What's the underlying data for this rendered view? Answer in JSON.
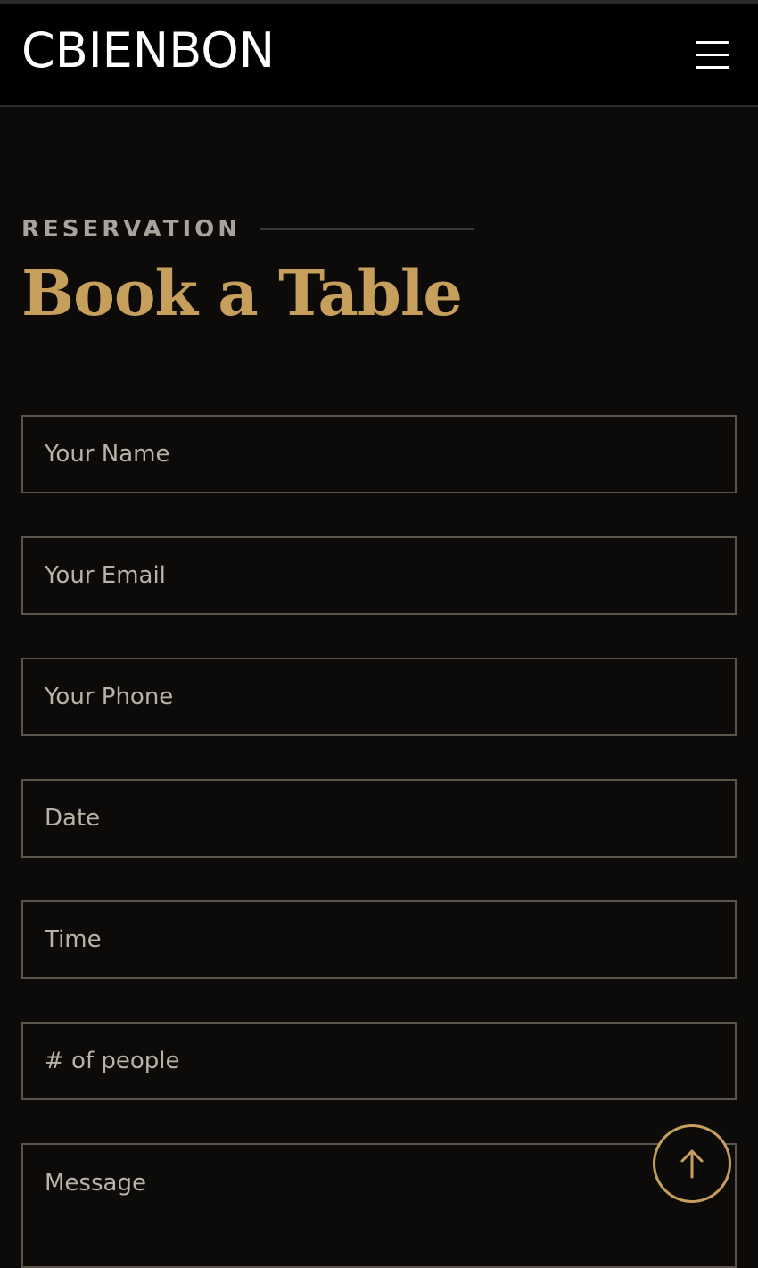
{
  "header": {
    "logo": "CBIENBON",
    "menu_icon": "hamburger-menu-icon"
  },
  "section": {
    "eyebrow": "RESERVATION",
    "title": "Book a Table"
  },
  "form": {
    "name_placeholder": "Your Name",
    "email_placeholder": "Your Email",
    "phone_placeholder": "Your Phone",
    "date_placeholder": "Date",
    "time_placeholder": "Time",
    "people_placeholder": "# of people",
    "message_placeholder": "Message"
  },
  "scroll_top": {
    "icon": "arrow-up-icon"
  },
  "colors": {
    "accent": "#c79f5c",
    "background": "#0d0b0a",
    "header_background": "#000000",
    "field_border": "#5a544a"
  }
}
